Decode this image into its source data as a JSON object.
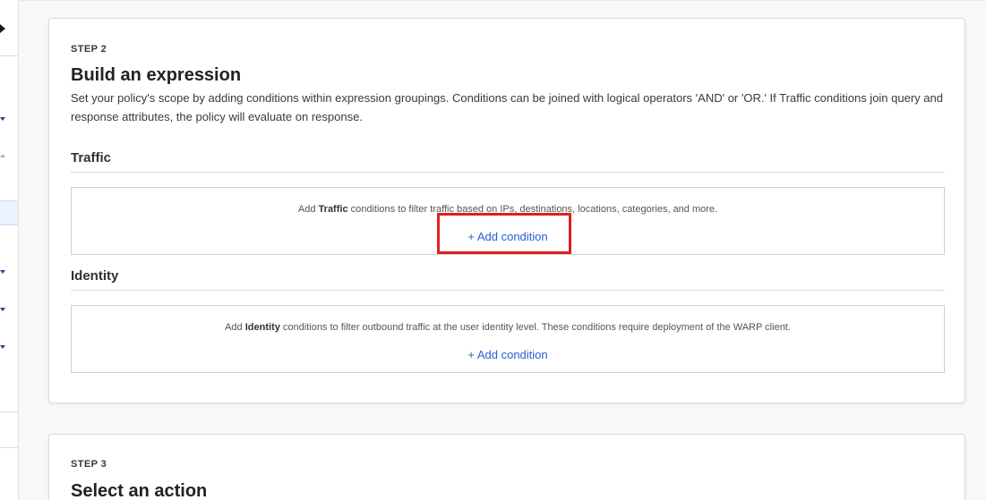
{
  "step2": {
    "step": "STEP 2",
    "title": "Build an expression",
    "description": "Set your policy's scope by adding conditions within expression groupings. Conditions can be joined with logical operators 'AND' or 'OR.' If Traffic conditions join query and response attributes, the policy will evaluate on response.",
    "traffic": {
      "heading": "Traffic",
      "text_prefix": "Add ",
      "text_bold": "Traffic",
      "text_suffix": " conditions to filter traffic based on IPs, destinations, locations, categories, and more.",
      "add_label": "+ Add condition"
    },
    "identity": {
      "heading": "Identity",
      "text_prefix": "Add ",
      "text_bold": "Identity",
      "text_suffix": " conditions to filter outbound traffic at the user identity level. These conditions require deployment of the WARP client.",
      "add_label": "+ Add condition"
    }
  },
  "step3": {
    "step": "STEP 3",
    "title": "Select an action"
  },
  "colors": {
    "link": "#2563c9",
    "highlight": "#e02020"
  }
}
